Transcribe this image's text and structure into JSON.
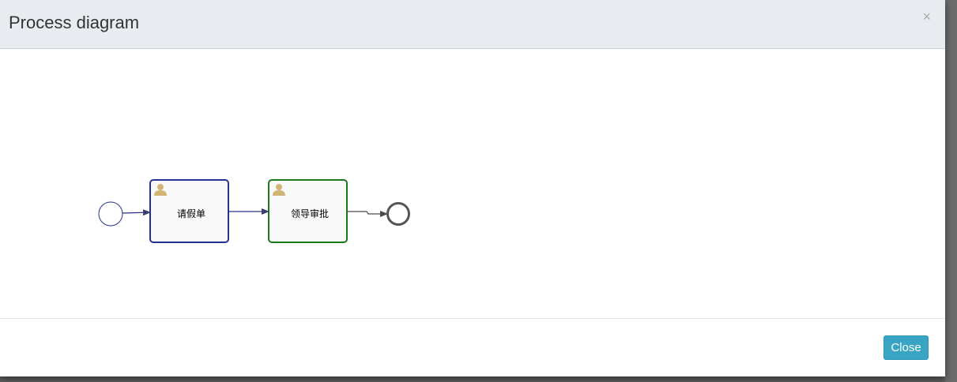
{
  "dialog": {
    "title": "Process diagram",
    "close_icon": "×",
    "close_button_label": "Close"
  },
  "diagram": {
    "start_event": {
      "name": "start-event"
    },
    "tasks": [
      {
        "label": "请假单",
        "icon": "user-icon",
        "border_color": "#27318f"
      },
      {
        "label": "领导审批",
        "icon": "user-icon",
        "border_color": "#1a7a1a"
      }
    ],
    "end_event": {
      "name": "end-event"
    }
  },
  "colors": {
    "header_bg": "#e8ecf0",
    "button_bg": "#39a5c4",
    "start_event": "#27318f",
    "active_flow": "#27318f",
    "end_event": "#555555"
  }
}
